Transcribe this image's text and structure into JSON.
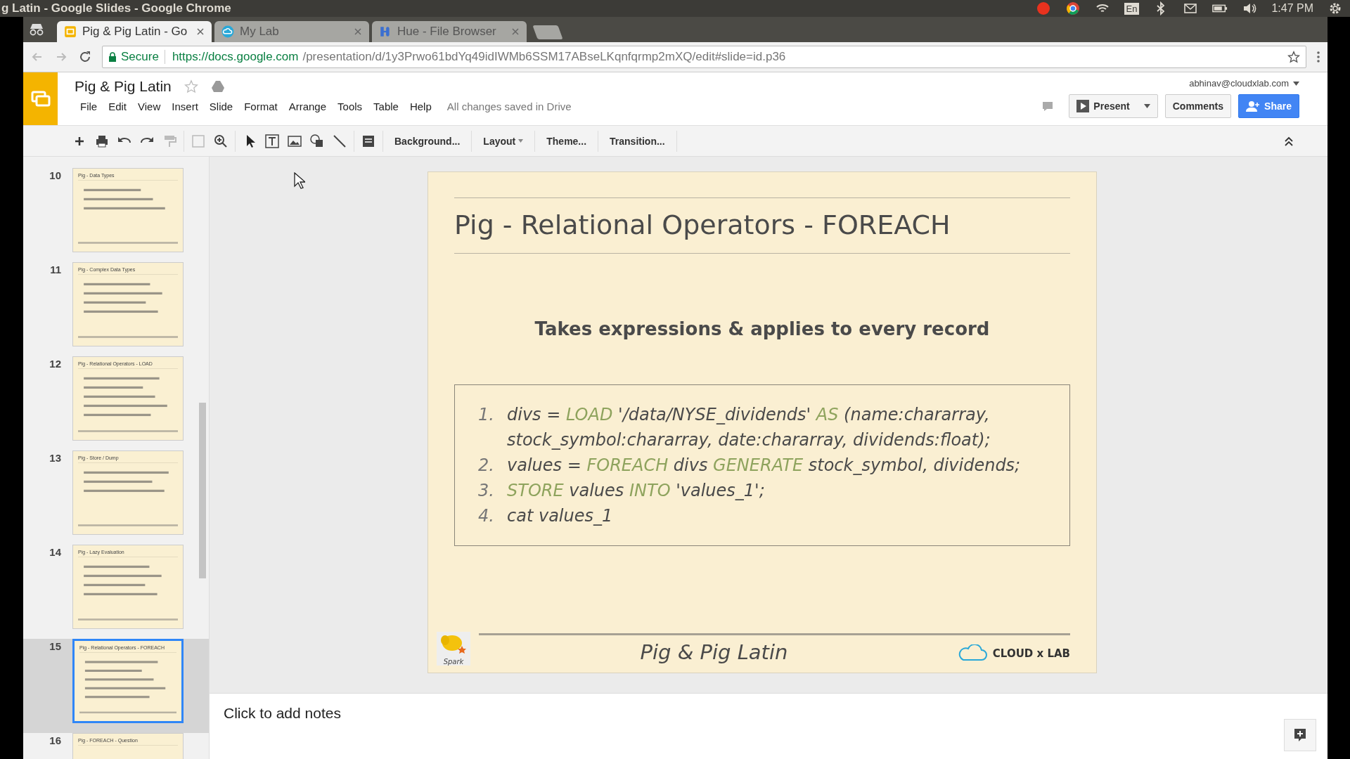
{
  "os_bar": {
    "title": "g Latin - Google Slides - Google Chrome",
    "keyboard": "En",
    "time": "1:47 PM"
  },
  "tabs": [
    {
      "title": "Pig & Pig Latin - Go",
      "kind": "slides",
      "selected": true
    },
    {
      "title": "My Lab",
      "kind": "cloud",
      "selected": false
    },
    {
      "title": "Hue - File Browser",
      "kind": "hue",
      "selected": false
    }
  ],
  "address_bar": {
    "secure_label": "Secure",
    "url_host": "https://docs.google.com",
    "url_path": "/presentation/d/1y3Prwo61bdYq49idIWMb6SSM17ABseLKqnfqrmp2mXQ/edit#slide=id.p36"
  },
  "document": {
    "title": "Pig & Pig Latin",
    "account": "abhinav@cloudxlab.com",
    "save_status": "All changes saved in Drive"
  },
  "menu": [
    "File",
    "Edit",
    "View",
    "Insert",
    "Slide",
    "Format",
    "Arrange",
    "Tools",
    "Table",
    "Help"
  ],
  "header_buttons": {
    "present": "Present",
    "comments": "Comments",
    "share": "Share"
  },
  "toolbar": [
    {
      "label": "Background...",
      "dropdown": false
    },
    {
      "label": "Layout",
      "dropdown": true
    },
    {
      "label": "Theme...",
      "dropdown": false
    },
    {
      "label": "Transition...",
      "dropdown": false
    }
  ],
  "filmstrip": [
    {
      "number": "10",
      "title": "Pig - Data Types",
      "selected": false
    },
    {
      "number": "11",
      "title": "Pig - Complex Data Types",
      "selected": false
    },
    {
      "number": "12",
      "title": "Pig - Relational Operators - LOAD",
      "selected": false
    },
    {
      "number": "13",
      "title": "Pig - Store / Dump",
      "selected": false
    },
    {
      "number": "14",
      "title": "Pig - Lazy Evaluation",
      "selected": false
    },
    {
      "number": "15",
      "title": "Pig - Relational Operators - FOREACH",
      "selected": true
    },
    {
      "number": "16",
      "title": "Pig - FOREACH - Question",
      "selected": false
    }
  ],
  "slide": {
    "title": "Pig - Relational Operators - FOREACH",
    "subtitle": "Takes expressions & applies to every record",
    "code": [
      {
        "number": "1.",
        "rows": [
          [
            {
              "text": "divs = ",
              "kind": "plain"
            },
            {
              "text": "LOAD",
              "kind": "keyword"
            },
            {
              "text": " '/data/NYSE_dividends' ",
              "kind": "plain"
            },
            {
              "text": "AS",
              "kind": "keyword"
            },
            {
              "text": " (name:chararray,",
              "kind": "plain"
            }
          ],
          [
            {
              "text": "stock_symbol:chararray, date:chararray, dividends:float);",
              "kind": "plain"
            }
          ]
        ]
      },
      {
        "number": "2.",
        "rows": [
          [
            {
              "text": "values = ",
              "kind": "plain"
            },
            {
              "text": "FOREACH",
              "kind": "keyword"
            },
            {
              "text": " divs ",
              "kind": "plain"
            },
            {
              "text": "GENERATE",
              "kind": "keyword"
            },
            {
              "text": " stock_symbol, dividends;",
              "kind": "plain"
            }
          ]
        ]
      },
      {
        "number": "3.",
        "rows": [
          [
            {
              "text": "STORE",
              "kind": "keyword"
            },
            {
              "text": " values ",
              "kind": "plain"
            },
            {
              "text": "INTO",
              "kind": "keyword"
            },
            {
              "text": " 'values_1';",
              "kind": "plain"
            }
          ]
        ]
      },
      {
        "number": "4.",
        "rows": [
          [
            {
              "text": "cat values_1",
              "kind": "plain"
            }
          ]
        ]
      }
    ],
    "logo_caption": "Spark",
    "footer": "Pig & Pig Latin",
    "brand": "CLOUD x LAB"
  },
  "notes": {
    "placeholder": "Click to add notes"
  }
}
